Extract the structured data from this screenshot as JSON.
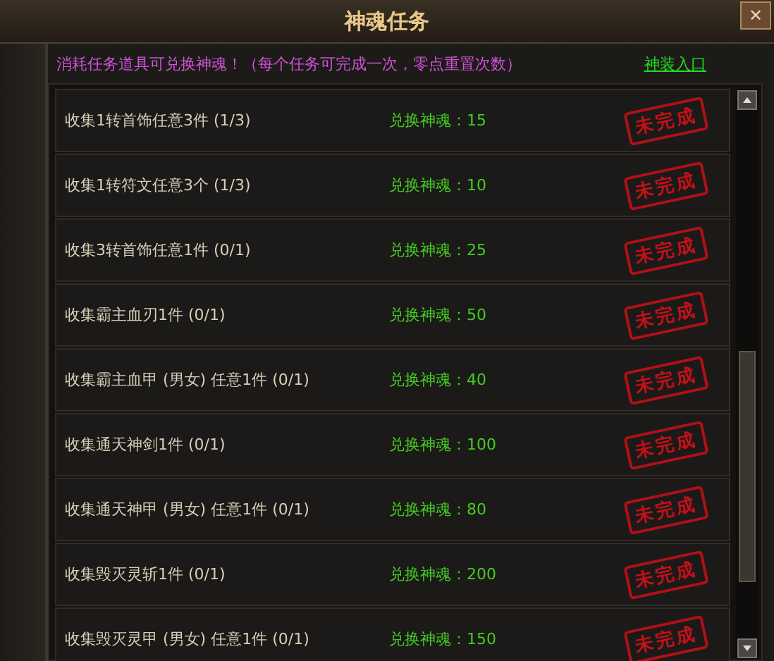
{
  "window": {
    "title": "神魂任务",
    "close": "✕"
  },
  "notice": {
    "text": "消耗任务道具可兑换神魂！（每个任务可完成一次，零点重置次数）",
    "link": "神装入口"
  },
  "tasks": [
    {
      "name": "收集1转首饰任意3件 (1/3)",
      "reward": "兑换神魂：15",
      "status": "未完成"
    },
    {
      "name": "收集1转符文任意3个 (1/3)",
      "reward": "兑换神魂：10",
      "status": "未完成"
    },
    {
      "name": "收集3转首饰任意1件 (0/1)",
      "reward": "兑换神魂：25",
      "status": "未完成"
    },
    {
      "name": "收集霸主血刃1件 (0/1)",
      "reward": "兑换神魂：50",
      "status": "未完成"
    },
    {
      "name": "收集霸主血甲 (男女) 任意1件 (0/1)",
      "reward": "兑换神魂：40",
      "status": "未完成"
    },
    {
      "name": "收集通天神剑1件 (0/1)",
      "reward": "兑换神魂：100",
      "status": "未完成"
    },
    {
      "name": "收集通天神甲 (男女) 任意1件 (0/1)",
      "reward": "兑换神魂：80",
      "status": "未完成"
    },
    {
      "name": "收集毁灭灵斩1件 (0/1)",
      "reward": "兑换神魂：200",
      "status": "未完成"
    },
    {
      "name": "收集毁灭灵甲 (男女) 任意1件 (0/1)",
      "reward": "兑换神魂：150",
      "status": "未完成"
    }
  ]
}
